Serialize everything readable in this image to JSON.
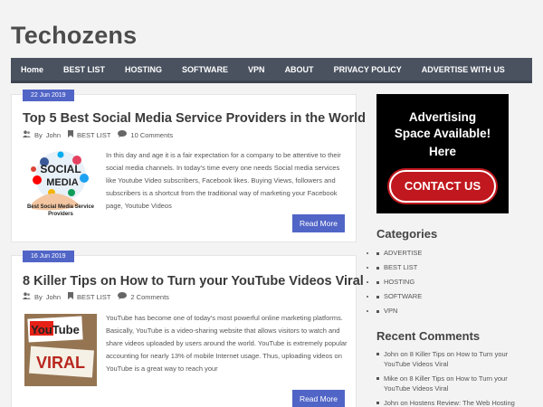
{
  "site": {
    "title": "Techozens"
  },
  "nav": [
    "Home",
    "BEST LIST",
    "HOSTING",
    "SOFTWARE",
    "VPN",
    "ABOUT",
    "PRIVACY POLICY",
    "ADVERTISE WITH US"
  ],
  "posts": [
    {
      "date": "22 Jun 2019",
      "title": "Top 5 Best Social Media Service Providers in the World",
      "author": "John",
      "category": "BEST LIST",
      "comments": "10 Comments",
      "thumb_caption": "Best Social Media Service Providers",
      "thumb_text_top": "SOCIAL",
      "thumb_text_bottom": "MEDIA",
      "excerpt": "In this day and age it is a fair expectation for a company to be attentive to their social media channels. In today's time every one needs Social media services like Youtube Video subscribers, Facebook likes. Buying Views, followers and subscribers is a shortcut from the traditional way of marketing your Facebook page, Youtube Videos",
      "read_more": "Read More"
    },
    {
      "date": "16 Jun 2019",
      "title": "8 Killer Tips on How to Turn your YouTube Videos Viral",
      "author": "John",
      "category": "BEST LIST",
      "comments": "2 Comments",
      "thumb_text_top": "YouTube",
      "thumb_text_bottom": "VIRAL",
      "excerpt": "YouTube has become one of today's most powerful online marketing platforms. Basically, YouTube is a video-sharing website that allows visitors to watch and share videos uploaded by users around the world. YouTube is extremely popular accounting for nearly 13% of mobile Internet usage. Thus, uploading videos on YouTube is a great way to reach your",
      "read_more": "Read More"
    }
  ],
  "meta_by": "By",
  "ad": {
    "line1": "Advertising",
    "line2": "Space Available!",
    "line3": "Here",
    "button": "CONTACT US"
  },
  "categories": {
    "title": "Categories",
    "items": [
      "ADVERTISE",
      "BEST LIST",
      "HOSTING",
      "SOFTWARE",
      "VPN"
    ]
  },
  "recent_comments": {
    "title": "Recent Comments",
    "items": [
      "John on 8 Killer Tips on How to Turn your YouTube Videos Viral",
      "Mike on 8 Killer Tips on How to Turn your YouTube Videos Viral",
      "John on Hostens Review: The Web Hosting"
    ]
  },
  "colors": {
    "accent": "#5165c7",
    "nav_bg": "#4a5260",
    "cta_red": "#c0181e"
  }
}
